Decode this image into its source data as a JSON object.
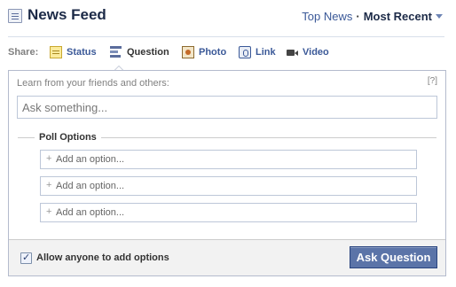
{
  "header": {
    "title": "News Feed",
    "icon": "news-feed-icon",
    "sort": {
      "top_news": "Top News",
      "separator": "·",
      "most_recent": "Most Recent"
    }
  },
  "share": {
    "label": "Share:",
    "items": [
      {
        "label": "Status",
        "icon": "status-icon",
        "active": false
      },
      {
        "label": "Question",
        "icon": "question-icon",
        "active": true
      },
      {
        "label": "Photo",
        "icon": "photo-icon",
        "active": false
      },
      {
        "label": "Link",
        "icon": "link-icon",
        "active": false
      },
      {
        "label": "Video",
        "icon": "video-icon",
        "active": false
      }
    ]
  },
  "composer": {
    "prompt": "Learn from your friends and others:",
    "help": "[?]",
    "question_placeholder": "Ask something...",
    "poll_title": "Poll Options",
    "option_placeholder": "Add an option...",
    "option_prefix": "+",
    "allow_label": "Allow anyone to add options",
    "allow_checked": true,
    "ask_button": "Ask Question"
  },
  "colors": {
    "link": "#3b5998",
    "title": "#1c2a47",
    "button": "#5b74a8"
  }
}
